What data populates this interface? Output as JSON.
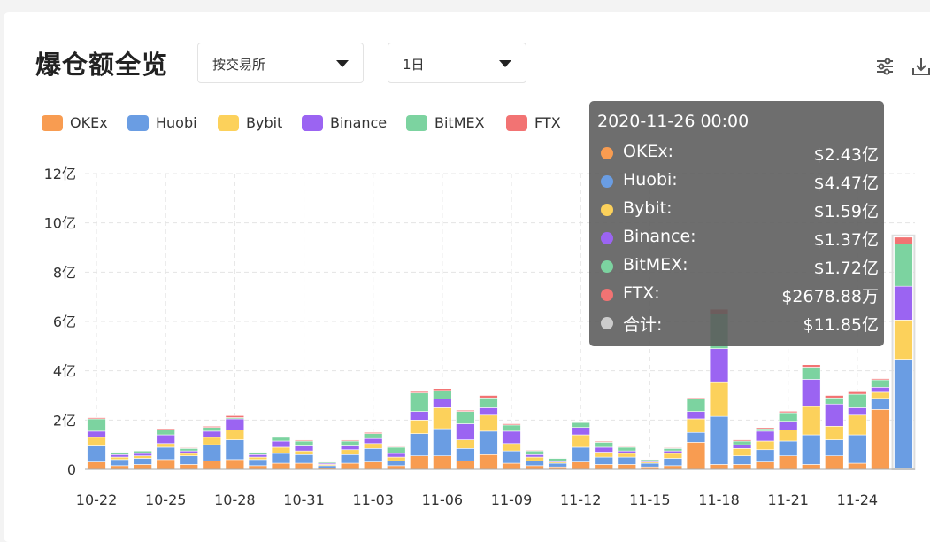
{
  "header": {
    "title": "爆仓额全览",
    "select_exchange": "按交易所",
    "select_period": "1日"
  },
  "colors": {
    "OKEx": "#f89c51",
    "Huobi": "#6a9de3",
    "Bybit": "#fcd15b",
    "Binance": "#9b64f2",
    "BitMEX": "#7cd3a0",
    "FTX": "#f27373"
  },
  "icons": [
    "settings-sliders-icon",
    "download-icon"
  ],
  "tooltip": {
    "time": "2020-11-26 00:00",
    "rows": [
      {
        "name": "OKEx:",
        "value": "$2.43亿",
        "color": "#f89c51"
      },
      {
        "name": "Huobi:",
        "value": "$4.47亿",
        "color": "#6a9de3"
      },
      {
        "name": "Bybit:",
        "value": "$1.59亿",
        "color": "#fcd15b"
      },
      {
        "name": "Binance:",
        "value": "$1.37亿",
        "color": "#9b64f2"
      },
      {
        "name": "BitMEX:",
        "value": "$1.72亿",
        "color": "#7cd3a0"
      },
      {
        "name": "FTX:",
        "value": "$2678.88万",
        "color": "#f27373"
      },
      {
        "name": "合计:",
        "value": "$11.85亿",
        "color": "#cccccc"
      }
    ]
  },
  "chart_data": {
    "type": "bar",
    "stacked": true,
    "unit": "亿 USD",
    "ylim": [
      0,
      12
    ],
    "yticks": [
      0,
      2,
      4,
      6,
      8,
      10,
      12
    ],
    "ytick_labels": [
      "0",
      "2亿",
      "4亿",
      "6亿",
      "8亿",
      "10亿",
      "12亿"
    ],
    "xtick_labels": [
      "10-22",
      "10-25",
      "10-28",
      "10-31",
      "11-03",
      "11-06",
      "11-09",
      "11-12",
      "11-15",
      "11-18",
      "11-21",
      "11-24"
    ],
    "grid": true,
    "legend_position": "top-left",
    "categories": [
      "10-22",
      "10-23",
      "10-24",
      "10-25",
      "10-26",
      "10-27",
      "10-28",
      "10-29",
      "10-30",
      "10-31",
      "11-01",
      "11-02",
      "11-03",
      "11-04",
      "11-05",
      "11-06",
      "11-07",
      "11-08",
      "11-09",
      "11-10",
      "11-11",
      "11-12",
      "11-13",
      "11-14",
      "11-15",
      "11-16",
      "11-17",
      "11-18",
      "11-19",
      "11-20",
      "11-21",
      "11-22",
      "11-23",
      "11-24",
      "11-25",
      "11-26"
    ],
    "highlight_index": 35,
    "series": [
      {
        "name": "OKEx",
        "values": [
          0.3,
          0.15,
          0.2,
          0.4,
          0.2,
          0.35,
          0.4,
          0.15,
          0.25,
          0.25,
          0.05,
          0.25,
          0.3,
          0.15,
          0.55,
          0.55,
          0.35,
          0.6,
          0.25,
          0.15,
          0.1,
          0.3,
          0.2,
          0.2,
          0.1,
          0.15,
          1.1,
          0.2,
          0.2,
          0.3,
          0.55,
          0.2,
          0.55,
          0.25,
          2.43
        ]
      },
      {
        "name": "Huobi",
        "values": [
          0.65,
          0.25,
          0.25,
          0.5,
          0.35,
          0.65,
          0.8,
          0.25,
          0.4,
          0.35,
          0.1,
          0.35,
          0.55,
          0.2,
          0.9,
          1.1,
          0.5,
          0.95,
          0.5,
          0.2,
          0.15,
          0.6,
          0.3,
          0.3,
          0.15,
          0.3,
          0.4,
          1.95,
          0.35,
          0.5,
          0.6,
          1.2,
          0.65,
          1.15,
          0.45,
          4.47
        ]
      },
      {
        "name": "Bybit",
        "values": [
          0.35,
          0.1,
          0.1,
          0.15,
          0.1,
          0.3,
          0.4,
          0.1,
          0.25,
          0.15,
          0.05,
          0.2,
          0.2,
          0.15,
          0.55,
          0.85,
          0.35,
          0.65,
          0.3,
          0.15,
          0.05,
          0.5,
          0.2,
          0.15,
          0.05,
          0.2,
          0.55,
          1.4,
          0.3,
          0.35,
          0.45,
          1.15,
          0.55,
          0.8,
          0.25,
          1.59
        ]
      },
      {
        "name": "Binance",
        "values": [
          0.25,
          0.1,
          0.1,
          0.35,
          0.1,
          0.25,
          0.45,
          0.1,
          0.25,
          0.2,
          0.05,
          0.15,
          0.2,
          0.15,
          0.35,
          0.35,
          0.65,
          0.3,
          0.5,
          0.1,
          0.05,
          0.3,
          0.2,
          0.1,
          0.05,
          0.1,
          0.3,
          1.35,
          0.15,
          0.4,
          0.35,
          1.1,
          0.9,
          0.3,
          0.2,
          1.37
        ]
      },
      {
        "name": "BitMEX",
        "values": [
          0.5,
          0.1,
          0.1,
          0.2,
          0.1,
          0.15,
          0.05,
          0.1,
          0.15,
          0.2,
          0.05,
          0.2,
          0.2,
          0.25,
          0.75,
          0.35,
          0.5,
          0.4,
          0.25,
          0.15,
          0.1,
          0.2,
          0.2,
          0.15,
          0.05,
          0.1,
          0.5,
          1.4,
          0.15,
          0.1,
          0.35,
          0.5,
          0.25,
          0.55,
          0.3,
          1.72
        ]
      },
      {
        "name": "FTX",
        "values": [
          0.05,
          0.02,
          0.02,
          0.05,
          0.03,
          0.05,
          0.08,
          0.02,
          0.04,
          0.04,
          0.01,
          0.04,
          0.05,
          0.03,
          0.06,
          0.08,
          0.05,
          0.1,
          0.05,
          0.03,
          0.02,
          0.05,
          0.04,
          0.03,
          0.02,
          0.03,
          0.05,
          0.2,
          0.05,
          0.05,
          0.06,
          0.1,
          0.1,
          0.1,
          0.05,
          0.27
        ]
      }
    ]
  }
}
